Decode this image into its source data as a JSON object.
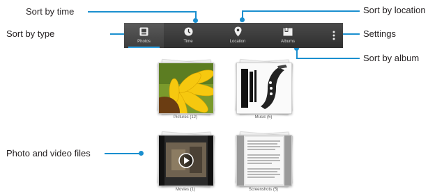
{
  "callouts": {
    "sort_by_time": "Sort by time",
    "sort_by_type": "Sort by type",
    "sort_by_location": "Sort by location",
    "settings": "Settings",
    "sort_by_album": "Sort by album",
    "photo_video_files": "Photo and video files"
  },
  "tabs": [
    {
      "label": "Photos",
      "icon": "photos-icon"
    },
    {
      "label": "Time",
      "icon": "clock-icon"
    },
    {
      "label": "Location",
      "icon": "location-pin-icon"
    },
    {
      "label": "Albums",
      "icon": "albums-icon"
    }
  ],
  "settings_icon": "overflow-menu-icon",
  "albums": [
    {
      "caption": "Pictures (12)",
      "thumb": "sunflower"
    },
    {
      "caption": "Music (5)",
      "thumb": "saxophone-poster"
    },
    {
      "caption": "Movies (1)",
      "thumb": "video-play"
    },
    {
      "caption": "Screenshots (5)",
      "thumb": "document"
    }
  ],
  "colors": {
    "accent": "#1a8fcf",
    "tabbar": "#3a3a3a",
    "tab_highlight": "#2fa3e6"
  }
}
